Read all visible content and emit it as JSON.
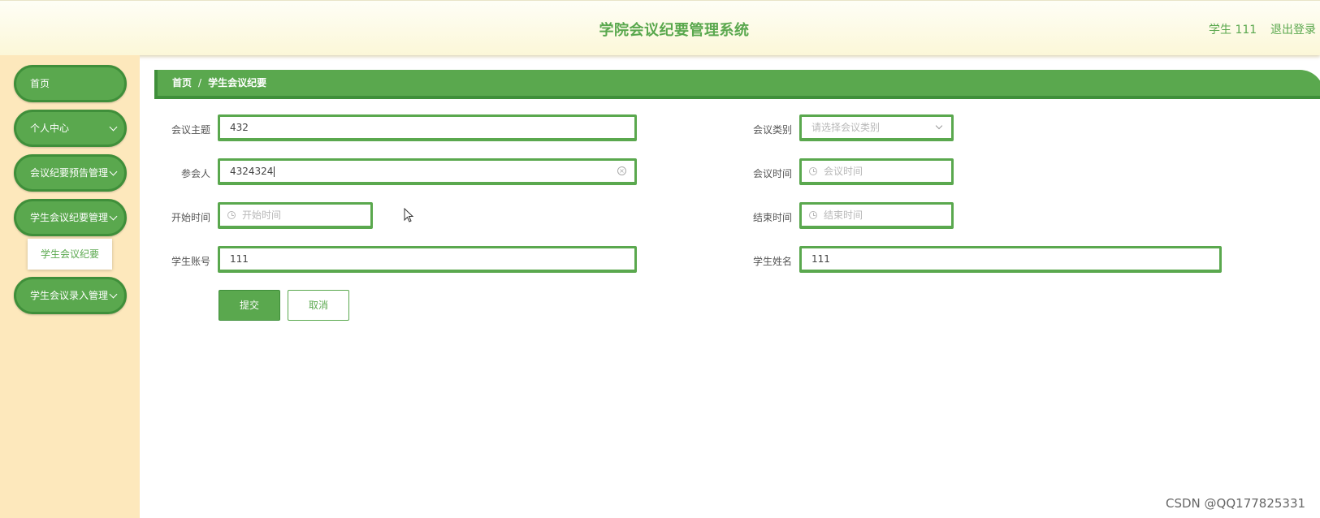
{
  "header": {
    "title": "学院会议纪要管理系统",
    "user": "学生 111",
    "logout": "退出登录"
  },
  "sidebar": {
    "items": [
      {
        "label": "首页"
      },
      {
        "label": "个人中心"
      },
      {
        "label": "会议纪要预告管理"
      },
      {
        "label": "学生会议纪要管理"
      },
      {
        "label": "学生会议录入管理"
      }
    ],
    "sub_item": "学生会议纪要"
  },
  "breadcrumb": {
    "home": "首页",
    "separator": "/",
    "current": "学生会议纪要"
  },
  "form": {
    "topic": {
      "label": "会议主题",
      "value": "432"
    },
    "category": {
      "label": "会议类别",
      "placeholder": "请选择会议类别"
    },
    "participants": {
      "label": "参会人",
      "value": "4324324"
    },
    "meeting_time": {
      "label": "会议时间",
      "placeholder": "会议时间"
    },
    "start_time": {
      "label": "开始时间",
      "placeholder": "开始时间"
    },
    "end_time": {
      "label": "结束时间",
      "placeholder": "结束时间"
    },
    "student_account": {
      "label": "学生账号",
      "value": "111"
    },
    "student_name": {
      "label": "学生姓名",
      "value": "111"
    },
    "submit": "提交",
    "cancel": "取消"
  },
  "watermark": "CSDN @QQ177825331",
  "colors": {
    "primary": "#5aa84e",
    "primary_dark": "#3f8f3a",
    "sidebar_bg": "#fde8bc",
    "header_bg": "#fcf7d8"
  },
  "icons": [
    "clock-icon",
    "clear-icon",
    "chevron-down-icon",
    "mouse-cursor-icon"
  ]
}
